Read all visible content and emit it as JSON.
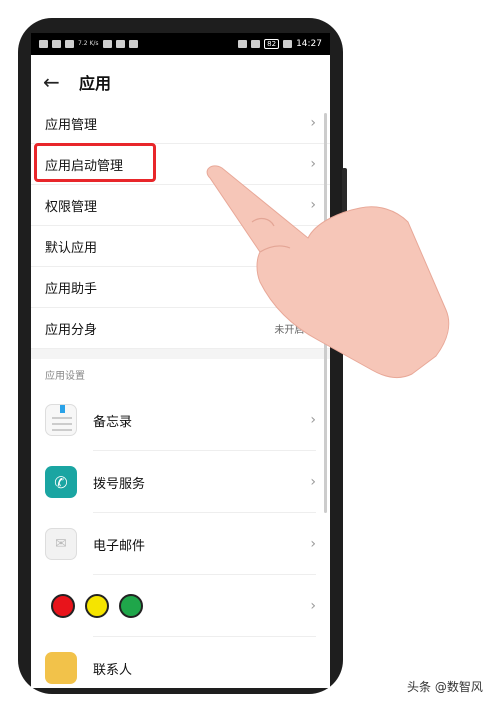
{
  "status_bar": {
    "left_net": "7.2\nK/s",
    "time": "14:27",
    "battery": "82"
  },
  "header": {
    "title": "应用"
  },
  "settings_rows": [
    {
      "label": "应用管理",
      "value": ""
    },
    {
      "label": "应用启动管理",
      "value": ""
    },
    {
      "label": "权限管理",
      "value": ""
    },
    {
      "label": "默认应用",
      "value": ""
    },
    {
      "label": "应用助手",
      "value": ""
    },
    {
      "label": "应用分身",
      "value": "未开启"
    }
  ],
  "section": {
    "label": "应用设置"
  },
  "apps": [
    {
      "label": "备忘录",
      "icon": "memo-icon"
    },
    {
      "label": "拨号服务",
      "icon": "phone-icon"
    },
    {
      "label": "电子邮件",
      "icon": "mail-icon"
    },
    {
      "label": "",
      "icon": "color-dots"
    },
    {
      "label": "联系人",
      "icon": "contact-icon"
    }
  ],
  "color_dots": [
    "#e8141b",
    "#f5e400",
    "#1fa64a"
  ],
  "colors": {
    "highlight": "#e8262a",
    "accent": "#1aa5a2"
  },
  "watermark": "头条 @数智风"
}
